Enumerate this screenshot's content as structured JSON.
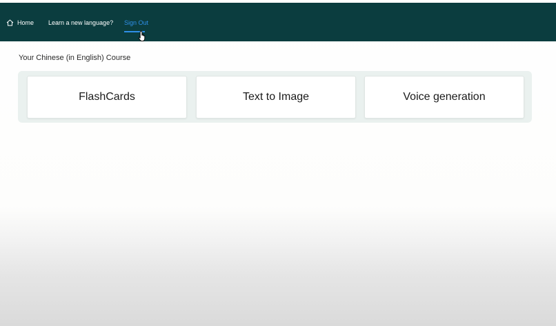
{
  "nav": {
    "home_label": "Home",
    "learn_label": "Learn a new language?",
    "signout_label": "Sign Out"
  },
  "icons": {
    "home": "home-icon",
    "cursor": "hand-pointer-icon"
  },
  "course": {
    "title": "Your Chinese (in English) Course"
  },
  "cards": [
    {
      "label": "FlashCards"
    },
    {
      "label": "Text to Image"
    },
    {
      "label": "Voice generation"
    }
  ],
  "colors": {
    "navbar": "#0b3d3f",
    "nav_text": "#ffffff",
    "active_link": "#2f8fe8",
    "panel": "#eaf1ef",
    "card": "#ffffff"
  }
}
